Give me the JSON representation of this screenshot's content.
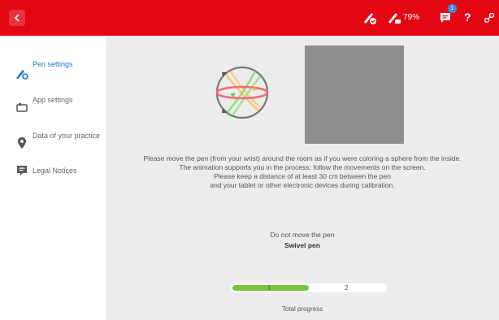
{
  "header": {
    "battery": "79%",
    "notification_count": "1",
    "help_label": "?"
  },
  "icons": {
    "back": "chevron-left-icon",
    "pen_connected": "pen-check-icon",
    "pen_battery": "pen-battery-icon",
    "notifications": "chat-icon",
    "help": "help-icon",
    "connect": "link-icon"
  },
  "sidebar": {
    "items": [
      {
        "label": "Pen settings",
        "icon": "pen-gear-icon",
        "active": true
      },
      {
        "label": "App settings",
        "icon": "app-icon",
        "active": false
      },
      {
        "label": "Data of your practice",
        "icon": "location-pin-icon",
        "active": false
      },
      {
        "label": "Legal Notices",
        "icon": "document-icon",
        "active": false
      }
    ]
  },
  "calibration": {
    "instructions": [
      "Please move the pen (from your wrist) around the room as if you were coloring a sphere from the inside.",
      "The animation supports you in the process: follow the movements on the screen.",
      "Please keep a distance of at least 30 cm between the pen",
      "and your tablet or other electronic devices during calibration."
    ],
    "status": "Do not move the pen",
    "step_name": "Swivel pen"
  },
  "progress": {
    "steps": [
      "1",
      "2"
    ],
    "current_step": 1,
    "fraction": 0.5,
    "caption": "Total progress"
  },
  "colors": {
    "brand_red": "#e30613",
    "active_blue": "#1a77c9",
    "progress_green": "#7ec13f",
    "main_bg": "#ececec"
  }
}
